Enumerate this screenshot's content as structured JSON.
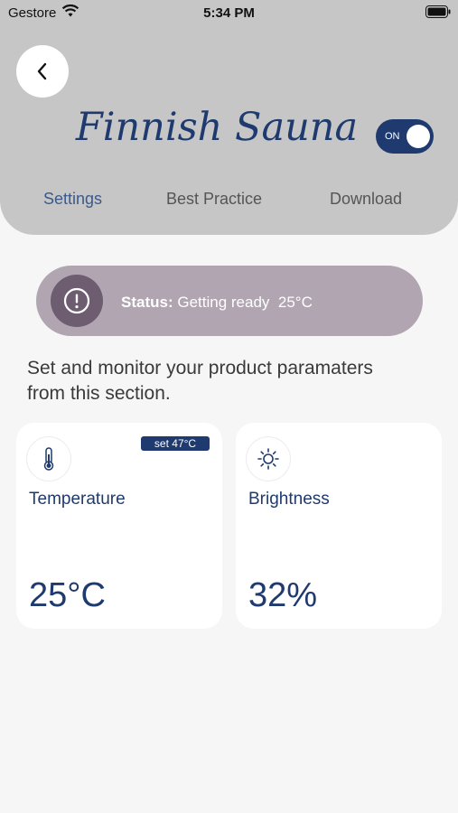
{
  "status_bar": {
    "carrier": "Gestore",
    "time": "5:34 PM",
    "wifi_icon": "wifi-icon",
    "battery_icon": "battery-icon"
  },
  "header": {
    "title": "Finnish Sauna",
    "back_icon": "chevron-left-icon",
    "power_toggle": {
      "label": "ON",
      "state": true
    }
  },
  "tabs": [
    {
      "label": "Settings",
      "active": true
    },
    {
      "label": "Best Practice",
      "active": false
    },
    {
      "label": "Download",
      "active": false
    }
  ],
  "status": {
    "icon": "alert-circle-icon",
    "label": "Status:",
    "value": "Getting ready  25°C"
  },
  "description": "Set and monitor your product paramaters from this section.",
  "cards": [
    {
      "icon": "thermometer-icon",
      "label": "Temperature",
      "badge": "set 47°C",
      "value": "25°C"
    },
    {
      "icon": "sun-icon",
      "label": "Brightness",
      "value": "32%"
    }
  ],
  "colors": {
    "brand": "#1f3a6e",
    "header_bg": "#c6c6c6",
    "status_pill": "#b0a5b1",
    "status_icon_bg": "#6e5c70"
  }
}
